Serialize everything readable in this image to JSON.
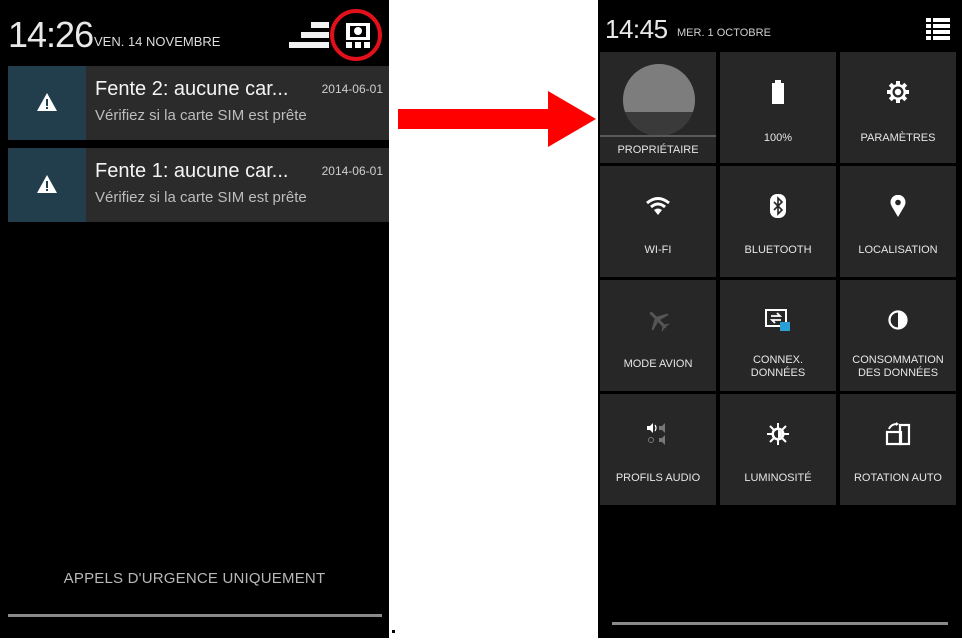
{
  "left": {
    "time": "14:26",
    "date": "VEN. 14 NOVEMBRE",
    "notifications": [
      {
        "title": "Fente 2: aucune car...",
        "time": "2014-06-01",
        "subtitle": "Vérifiez si la carte SIM est prête",
        "icon": "warning-icon"
      },
      {
        "title": "Fente 1: aucune car...",
        "time": "2014-06-01",
        "subtitle": "Vérifiez si la carte SIM est prête",
        "icon": "warning-icon"
      }
    ],
    "emergency": "APPELS D'URGENCE UNIQUEMENT",
    "highlight_color": "#e2101a"
  },
  "arrow_color": "#ff0000",
  "right": {
    "time": "14:45",
    "date": "MER. 1 OCTOBRE",
    "tiles": [
      {
        "label": "PROPRIÉTAIRE",
        "icon": "avatar-icon"
      },
      {
        "label": "100%",
        "icon": "battery-icon"
      },
      {
        "label": "PARAMÈTRES",
        "icon": "gear-icon"
      },
      {
        "label": "WI-FI",
        "icon": "wifi-icon"
      },
      {
        "label": "BLUETOOTH",
        "icon": "bluetooth-icon"
      },
      {
        "label": "LOCALISATION",
        "icon": "location-pin-icon"
      },
      {
        "label": "MODE AVION",
        "icon": "airplane-icon"
      },
      {
        "label": "CONNEX.\nDONNÉES",
        "icon": "data-connection-icon"
      },
      {
        "label": "CONSOMMATION\nDES DONNÉES",
        "icon": "data-usage-icon"
      },
      {
        "label": "PROFILS AUDIO",
        "icon": "audio-profiles-icon"
      },
      {
        "label": "LUMINOSITÉ",
        "icon": "brightness-icon"
      },
      {
        "label": "ROTATION AUTO",
        "icon": "auto-rotate-icon"
      }
    ]
  }
}
